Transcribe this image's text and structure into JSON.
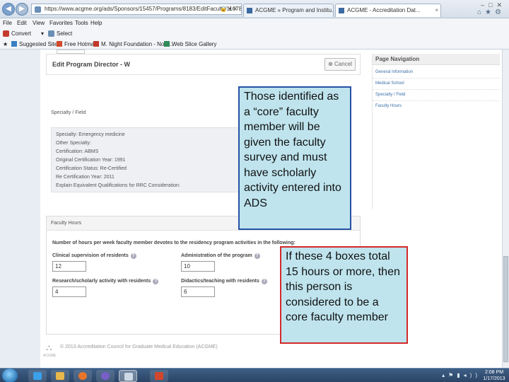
{
  "browser": {
    "url": "https://www.acgme.org/ads/Sponsors/15457/Programs/8183/EditFaculty/1167850?Ro",
    "tabs": [
      {
        "label": "ACGME » Program and Institu..."
      },
      {
        "label": "ACGME - Accreditation Dat..."
      }
    ],
    "menu": [
      "File",
      "Edit",
      "View",
      "Favorites",
      "Tools",
      "Help"
    ],
    "command_bar": {
      "convert": "Convert",
      "select": "Select"
    },
    "favorites": [
      "Suggested Sites",
      "Free Hotmail",
      "M. Night Foundation - Now...",
      "Web Slice Gallery"
    ]
  },
  "dialog": {
    "title": "Edit Program Director - W",
    "cancel_label": "Cancel"
  },
  "specialty_section": {
    "heading": "Specialty / Field",
    "lines": [
      "Specialty: Emergency medicine",
      "Other Specialty:",
      "Certification: ABMS",
      "Original Certification Year: 1991",
      "Certification Status: Re-Certified",
      "Re Certification Year: 2011",
      "Explain Equivalent Qualifications for RRC Consideration:"
    ]
  },
  "faculty_hours": {
    "heading": "Faculty Hours",
    "question": "Number of hours per week faculty member devotes to the residency program activities in the following:",
    "fields": [
      {
        "label": "Clinical supervision of residents",
        "value": "12"
      },
      {
        "label": "Administration of the program",
        "value": "10"
      },
      {
        "label": "Research/scholarly activity with residents",
        "value": "4"
      },
      {
        "label": "Didactics/teaching with residents",
        "value": "6"
      }
    ]
  },
  "page_navigation": {
    "heading": "Page Navigation",
    "links": [
      "General Information",
      "Medical School",
      "Specialty / Field",
      "Faculty Hours"
    ]
  },
  "footer": {
    "text": "© 2013 Accreditation Council for Graduate Medical Education (ACGME)",
    "logo_text": "ACGME"
  },
  "callouts": {
    "core_faculty": "Those identified as a “core” faculty member will be given the faculty survey and must have scholarly activity entered into ADS",
    "four_boxes": "If these 4 boxes total 15 hours or more, then this person is considered to be a core faculty member"
  },
  "taskbar": {
    "time": "2:08 PM",
    "date": "1/17/2013"
  },
  "icons": [
    "back-icon",
    "forward-icon",
    "page-icon",
    "star-icon",
    "home-icon",
    "gear-icon",
    "help-icon",
    "windows-start-icon",
    "ie-icon",
    "folder-icon",
    "firefox-icon",
    "media-icon",
    "powerpoint-icon"
  ]
}
